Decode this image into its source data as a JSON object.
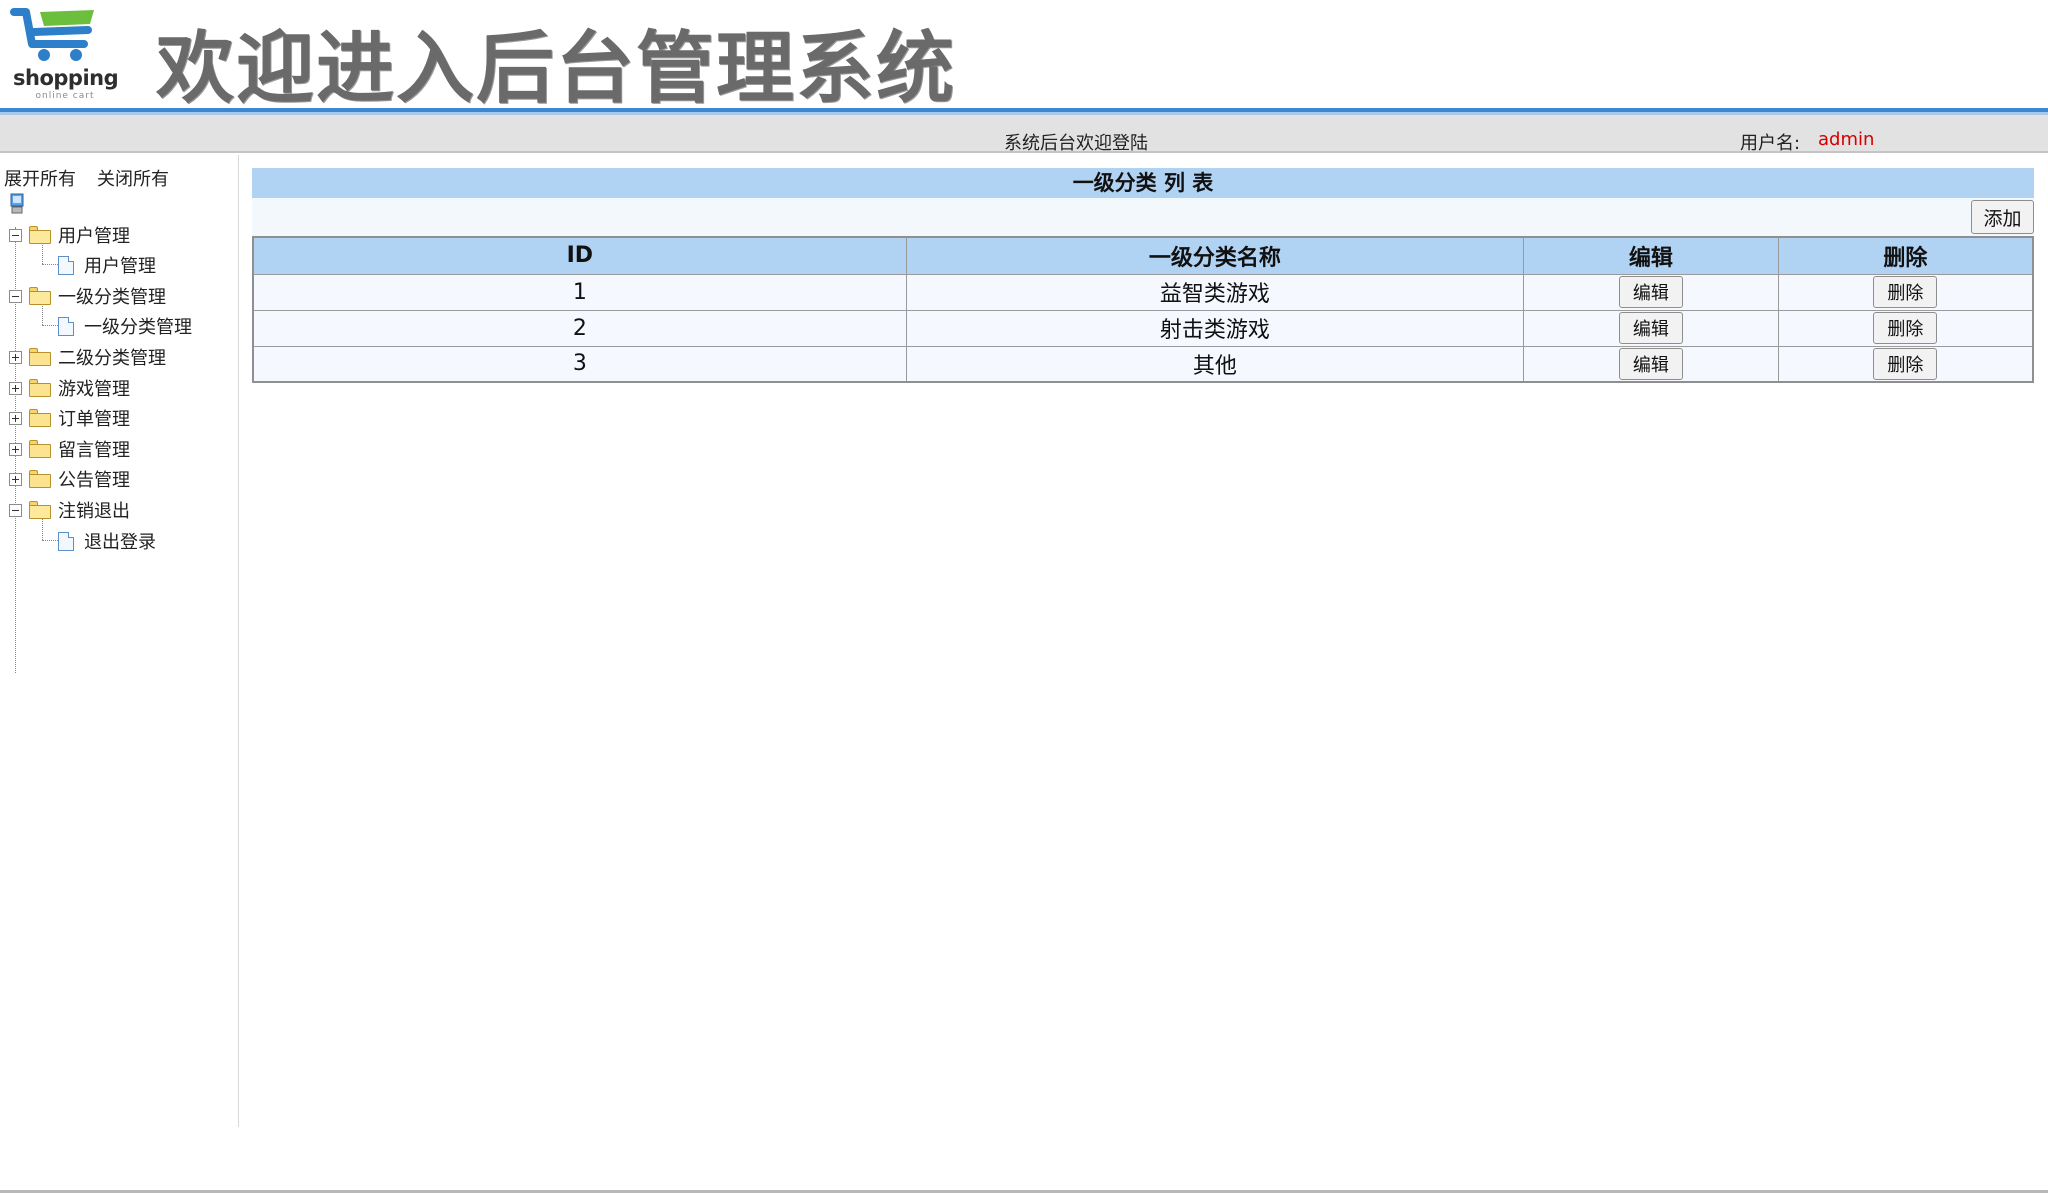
{
  "header": {
    "logo_text": "shopping",
    "logo_sub": "online cart",
    "title": "欢迎进入后台管理系统"
  },
  "status_bar": {
    "welcome": "系统后台欢迎登陆",
    "user_label": "用户名:",
    "user_value": "admin"
  },
  "sidebar": {
    "expand_all": "展开所有",
    "collapse_all": "关闭所有",
    "nodes": [
      {
        "label": "用户管理",
        "expanded": true,
        "children": [
          "用户管理"
        ]
      },
      {
        "label": "一级分类管理",
        "expanded": true,
        "children": [
          "一级分类管理"
        ]
      },
      {
        "label": "二级分类管理",
        "expanded": false,
        "children": []
      },
      {
        "label": "游戏管理",
        "expanded": false,
        "children": []
      },
      {
        "label": "订单管理",
        "expanded": false,
        "children": []
      },
      {
        "label": "留言管理",
        "expanded": false,
        "children": []
      },
      {
        "label": "公告管理",
        "expanded": false,
        "children": []
      },
      {
        "label": "注销退出",
        "expanded": true,
        "children": [
          "退出登录"
        ]
      }
    ]
  },
  "main": {
    "list_title": "一级分类 列 表",
    "add_label": "添加",
    "columns": [
      "ID",
      "一级分类名称",
      "编辑",
      "删除"
    ],
    "rows": [
      {
        "id": "1",
        "name": "益智类游戏",
        "edit": "编辑",
        "delete": "删除"
      },
      {
        "id": "2",
        "name": "射击类游戏",
        "edit": "编辑",
        "delete": "删除"
      },
      {
        "id": "3",
        "name": "其他",
        "edit": "编辑",
        "delete": "删除"
      }
    ]
  },
  "colors": {
    "accent_blue": "#3d86d0",
    "header_blue": "#b0d2f3",
    "username_red": "#d40000"
  }
}
